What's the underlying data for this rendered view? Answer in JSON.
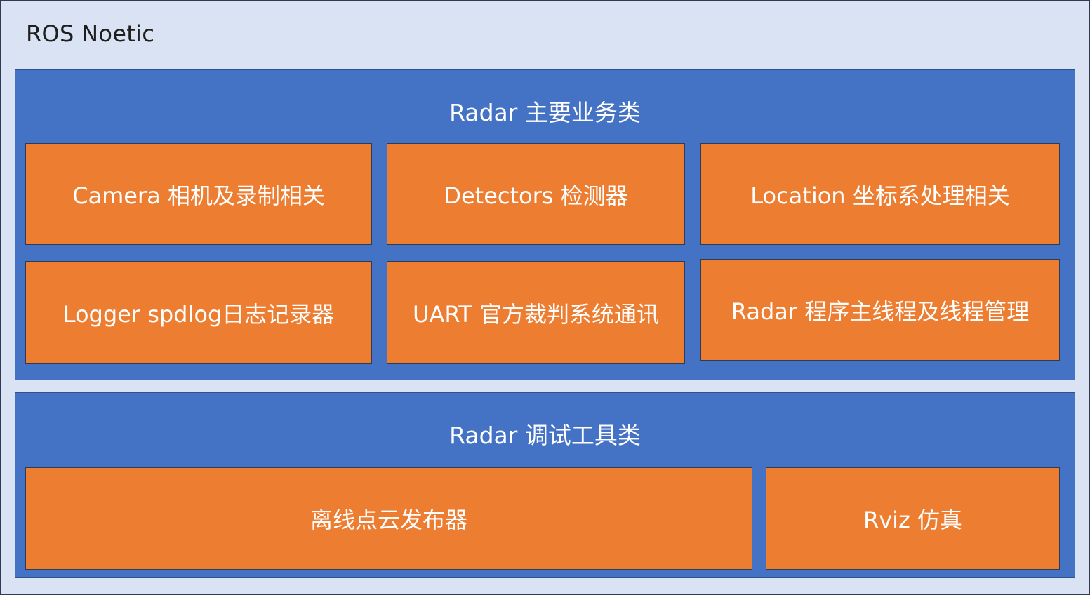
{
  "platform": {
    "title": "ROS Noetic"
  },
  "main_group": {
    "title": "Radar 主要业务类",
    "modules": [
      "Camera 相机及录制相关",
      "Detectors 检测器",
      "Location 坐标系处理相关",
      "Logger spdlog日志记录器",
      "UART 官方裁判系统通讯",
      "Radar 程序主线程及线程管理"
    ]
  },
  "debug_group": {
    "title": "Radar 调试工具类",
    "modules": [
      "离线点云发布器",
      "Rviz 仿真"
    ]
  },
  "colors": {
    "platform_bg": "#dae3f3",
    "group_bg": "#4472c4",
    "module_bg": "#ed7d31"
  }
}
